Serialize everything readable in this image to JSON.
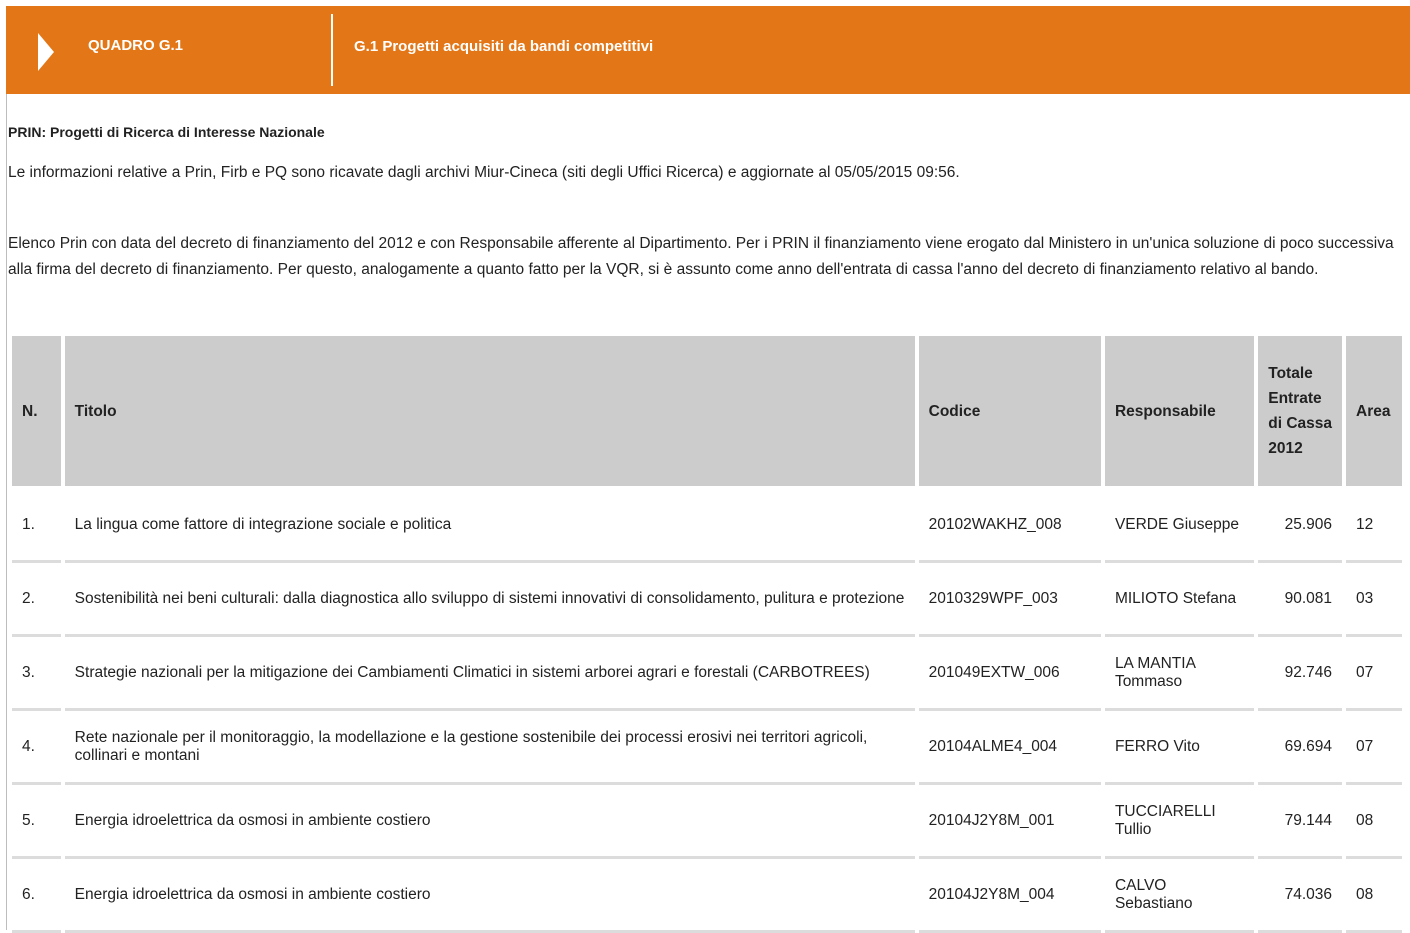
{
  "header": {
    "code": "QUADRO G.1",
    "title": "G.1 Progetti acquisiti da bandi competitivi"
  },
  "section": {
    "title": "PRIN: Progetti di Ricerca di Interesse Nazionale",
    "info": "Le informazioni relative a Prin, Firb e PQ sono ricavate dagli archivi Miur-Cineca (siti degli Uffici Ricerca) e aggiornate al 05/05/2015 09:56.",
    "description": "Elenco Prin con data del decreto di finanziamento del 2012 e con Responsabile afferente al Dipartimento. Per i PRIN il finanziamento viene erogato dal Ministero in un'unica soluzione di poco successiva alla firma del decreto di finanziamento. Per questo, analogamente a quanto fatto per la VQR, si è assunto come anno dell'entrata di cassa l'anno del decreto di finanziamento relativo al bando."
  },
  "table": {
    "headers": {
      "n": "N.",
      "titolo": "Titolo",
      "codice": "Codice",
      "responsabile": "Responsabile",
      "totale": "Totale Entrate di Cassa 2012",
      "area": "Area"
    },
    "rows": [
      {
        "n": "1.",
        "titolo": "La lingua come fattore di integrazione sociale e politica",
        "codice": "20102WAKHZ_008",
        "responsabile": "VERDE Giuseppe",
        "totale": "25.906",
        "area": "12"
      },
      {
        "n": "2.",
        "titolo": "Sostenibilità nei beni culturali: dalla diagnostica allo sviluppo di sistemi innovativi di consolidamento, pulitura e protezione",
        "codice": "2010329WPF_003",
        "responsabile": "MILIOTO Stefana",
        "totale": "90.081",
        "area": "03"
      },
      {
        "n": "3.",
        "titolo": "Strategie nazionali per la mitigazione dei Cambiamenti Climatici in sistemi arborei agrari e forestali (CARBOTREES)",
        "codice": "201049EXTW_006",
        "responsabile": "LA MANTIA Tommaso",
        "totale": "92.746",
        "area": "07"
      },
      {
        "n": "4.",
        "titolo": "Rete nazionale per il monitoraggio, la modellazione e la gestione sostenibile dei processi erosivi nei territori agricoli, collinari e montani",
        "codice": "20104ALME4_004",
        "responsabile": "FERRO Vito",
        "totale": "69.694",
        "area": "07"
      },
      {
        "n": "5.",
        "titolo": "Energia idroelettrica da osmosi in ambiente costiero",
        "codice": "20104J2Y8M_001",
        "responsabile": "TUCCIARELLI Tullio",
        "totale": "79.144",
        "area": "08"
      },
      {
        "n": "6.",
        "titolo": "Energia idroelettrica da osmosi in ambiente costiero",
        "codice": "20104J2Y8M_004",
        "responsabile": "CALVO Sebastiano",
        "totale": "74.036",
        "area": "08"
      }
    ]
  },
  "colors": {
    "header_bg": "#e37616",
    "table_header_bg": "#cccccc"
  }
}
